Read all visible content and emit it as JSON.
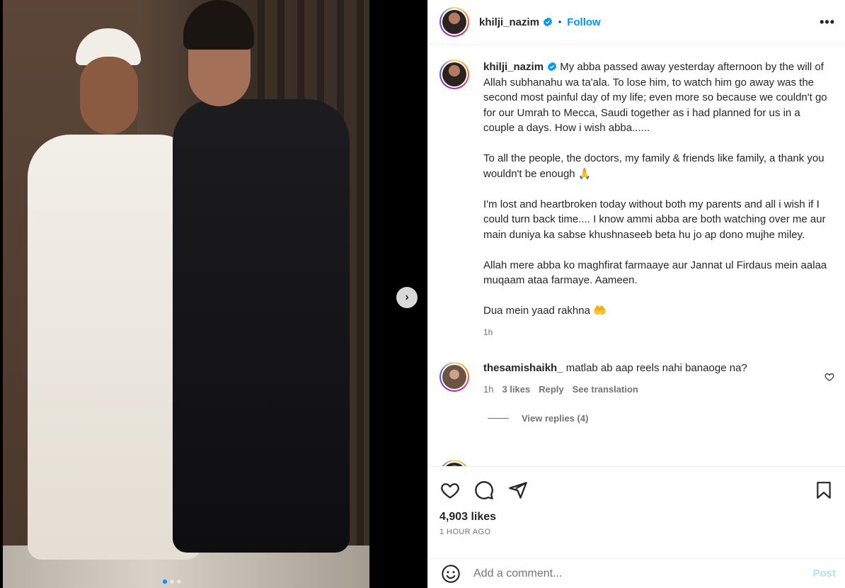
{
  "post": {
    "username": "khilji_nazim",
    "follow_label": "Follow",
    "more_label": "•••",
    "next_label": "›",
    "caption": {
      "username": "khilji_nazim",
      "paragraphs": [
        "My abba passed away yesterday afternoon by the will of Allah subhanahu wa ta'ala. To lose him, to watch him go away was the second most painful day of my life; even more so because we couldn't go for our Umrah to Mecca, Saudi together as i had planned for us in a couple a days. How i wish abba......",
        "To all the people, the doctors, my family & friends like family, a thank you wouldn't be enough 🙏",
        "I'm lost and heartbroken today without both my parents and all i wish if I could turn back time.... I know ammi abba are both watching over me aur main duniya ka sabse khushnaseeb beta hu jo ap dono mujhe miley.",
        "Allah mere abba ko maghfirat farmaaye aur Jannat ul Firdaus mein aalaa muqaam ataa farmaye. Aameen.",
        "Dua mein yaad rakhna 🤲"
      ],
      "time": "1h"
    },
    "comment": {
      "username": "thesamishaikh_",
      "text": "matlab ab aap reels nahi banaoge na?",
      "time": "1h",
      "likes": "3 likes",
      "reply_label": "Reply",
      "translate_label": "See translation",
      "view_replies": "View replies (4)"
    },
    "likes": "4,903 likes",
    "ago": "1 HOUR AGO",
    "add_comment_placeholder": "Add a comment...",
    "post_label": "Post"
  },
  "colors": {
    "accent": "#0095f6",
    "muted": "#737373",
    "post_disabled": "#b2dffc"
  },
  "icons": [
    "verified-icon",
    "more-icon",
    "next-arrow-icon",
    "heart-icon",
    "comment-icon",
    "share-icon",
    "bookmark-icon",
    "emoji-icon"
  ]
}
